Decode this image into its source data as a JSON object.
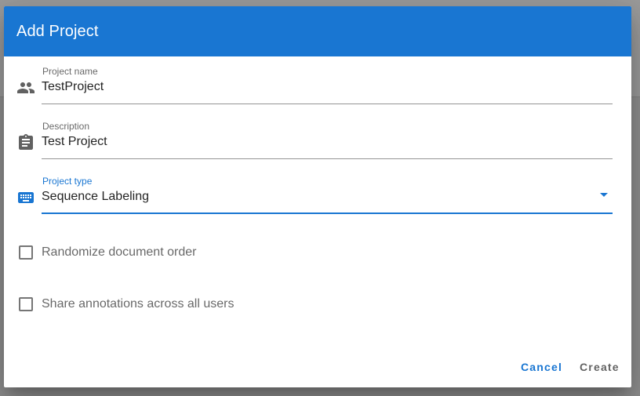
{
  "dialog": {
    "title": "Add Project"
  },
  "fields": {
    "project_name": {
      "label": "Project name",
      "value": "TestProject",
      "icon": "people-icon"
    },
    "description": {
      "label": "Description",
      "value": "Test Project",
      "icon": "clipboard-icon"
    },
    "project_type": {
      "label": "Project type",
      "value": "Sequence Labeling",
      "icon": "keyboard-icon"
    }
  },
  "checkboxes": {
    "randomize": {
      "label": "Randomize document order",
      "checked": false
    },
    "share": {
      "label": "Share annotations across all users",
      "checked": false
    }
  },
  "actions": {
    "cancel_label": "Cancel",
    "create_label": "Create"
  },
  "colors": {
    "primary": "#1976d2",
    "header_text": "#ffffff",
    "icon": "#5f5f5f",
    "backdrop": "#8f8f8f"
  }
}
